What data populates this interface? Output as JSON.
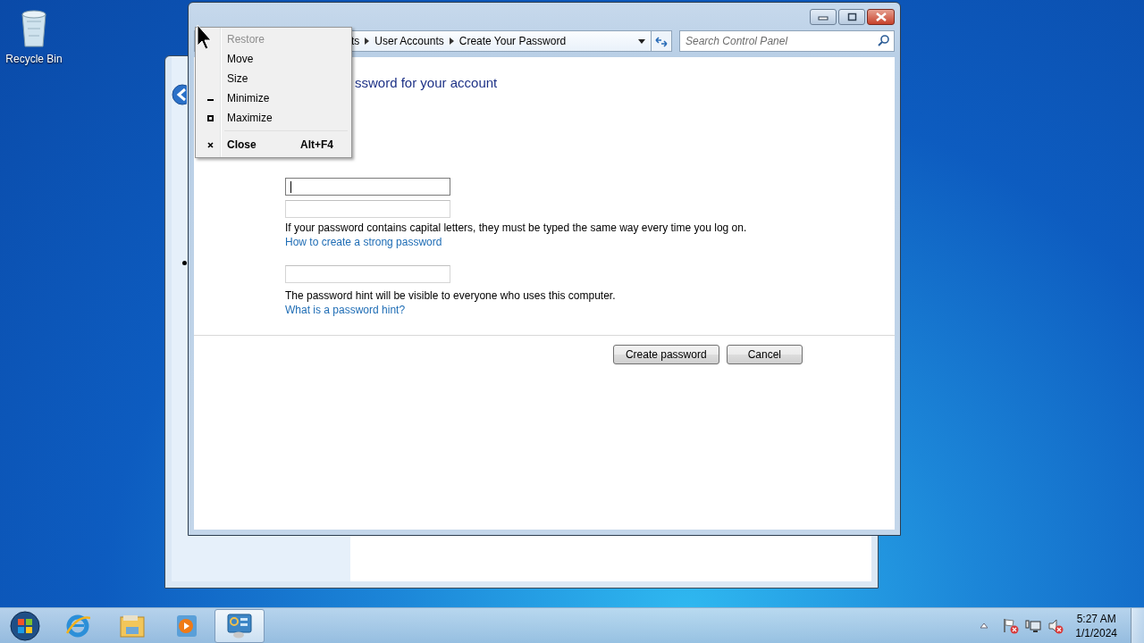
{
  "desktop_icons": [
    {
      "label": "Recycle Bin"
    }
  ],
  "window": {
    "breadcrumb": [
      {
        "label": "ts"
      },
      {
        "label": "User Accounts"
      },
      {
        "label": "Create Your Password"
      }
    ],
    "search": {
      "placeholder": "Search Control Panel"
    },
    "heading": "ssword for your account",
    "fields": [
      {
        "focused": true
      },
      {
        "focused": false
      }
    ],
    "note": "If your password contains capital letters, they must be typed the same way every time you log on.",
    "link": "How to create a strong password",
    "hint_field": {
      "focused": false
    },
    "hint_note": "The password hint will be visible to everyone who uses this computer.",
    "hint_link": "What is a password hint?",
    "buttons": [
      {
        "label": "Create password"
      },
      {
        "label": "Cancel"
      }
    ]
  },
  "menu": [
    {
      "kind": "plain",
      "label": "Restore",
      "disabled": true,
      "default": false
    },
    {
      "kind": "plain",
      "label": "Move",
      "disabled": false,
      "default": false
    },
    {
      "kind": "plain",
      "label": "Size",
      "disabled": false,
      "default": false
    },
    {
      "kind": "minimize",
      "label": "Minimize",
      "disabled": false,
      "default": false
    },
    {
      "kind": "maximize",
      "label": "Maximize",
      "disabled": false,
      "default": false
    },
    {
      "kind": "separator"
    },
    {
      "kind": "close",
      "label": "Close",
      "shortcut": "Alt+F4",
      "disabled": false,
      "default": true
    }
  ],
  "taskbar": {
    "apps": [
      {
        "kind": "browser",
        "selected": false
      },
      {
        "kind": "folder",
        "selected": false
      },
      {
        "kind": "media",
        "selected": false
      },
      {
        "kind": "control-panel",
        "selected": true
      }
    ],
    "clock": {
      "time": "5:27 AM",
      "date": "1/1/2024"
    }
  }
}
